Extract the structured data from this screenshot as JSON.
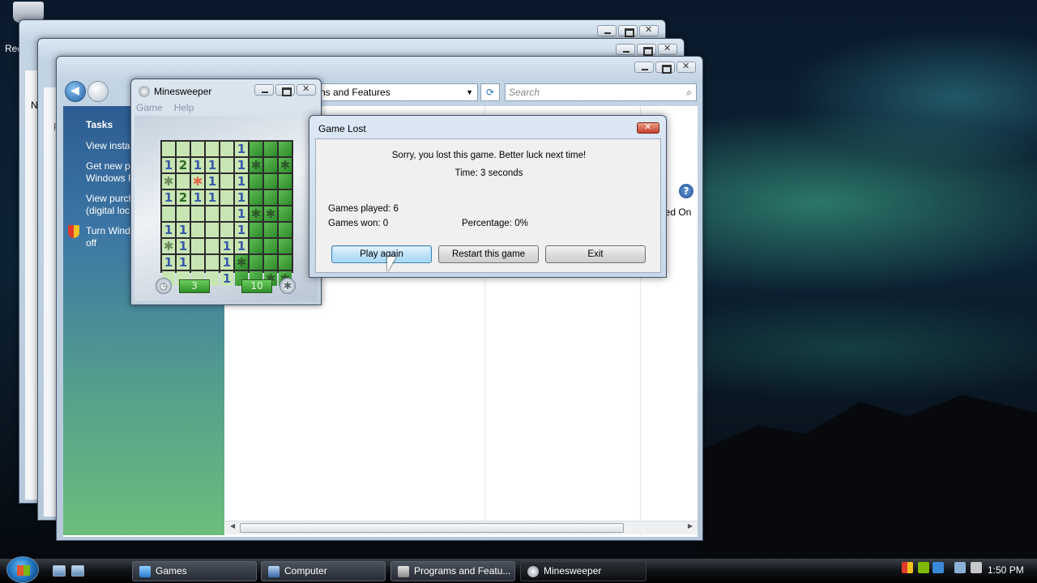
{
  "desktop": {
    "recycle_bin_label": "Rec"
  },
  "explorer": {
    "address_text": "ns and Features",
    "search_placeholder": "Search",
    "column_header": "led On",
    "tasks_title": "Tasks",
    "tasks": [
      "View insta",
      "Get new p\nWindows F",
      "View purch\n(digital loc",
      "Turn Wind\noff"
    ],
    "back_window_letters": [
      "N",
      "F",
      "F"
    ]
  },
  "minesweeper": {
    "title": "Minesweeper",
    "menu": [
      "Game",
      "Help"
    ],
    "time_counter": "3",
    "mines_counter": "10",
    "board": [
      [
        "o",
        "o",
        "o",
        "o",
        "o",
        "1",
        "c",
        "c",
        "c"
      ],
      [
        "1",
        "2",
        "1",
        "1",
        "o",
        "1",
        "M",
        "c",
        "M"
      ],
      [
        "m",
        "o",
        "X",
        "1",
        "o",
        "1",
        "c",
        "c",
        "c"
      ],
      [
        "1",
        "2",
        "1",
        "1",
        "o",
        "1",
        "c",
        "c",
        "c"
      ],
      [
        "o",
        "o",
        "o",
        "o",
        "o",
        "1",
        "M",
        "M",
        "c"
      ],
      [
        "1",
        "1",
        "o",
        "o",
        "o",
        "1",
        "c",
        "c",
        "c"
      ],
      [
        "m",
        "1",
        "o",
        "o",
        "1",
        "1",
        "c",
        "c",
        "c"
      ],
      [
        "1",
        "1",
        "o",
        "o",
        "1",
        "M",
        "c",
        "c",
        "c"
      ],
      [
        "o",
        "o",
        "o",
        "o",
        "1",
        "c",
        "c",
        "M",
        "M"
      ]
    ]
  },
  "dialog": {
    "title": "Game Lost",
    "message": "Sorry, you lost this game. Better luck next time!",
    "time": "Time: 3 seconds",
    "games_played": "Games played: 6",
    "games_won": "Games won: 0",
    "percentage": "Percentage: 0%",
    "buttons": {
      "play_again": "Play again",
      "restart": "Restart this game",
      "exit": "Exit"
    }
  },
  "taskbar": {
    "items": [
      "Games",
      "Computer",
      "Programs and Featu...",
      "Minesweeper"
    ],
    "clock": "1:50 PM"
  }
}
